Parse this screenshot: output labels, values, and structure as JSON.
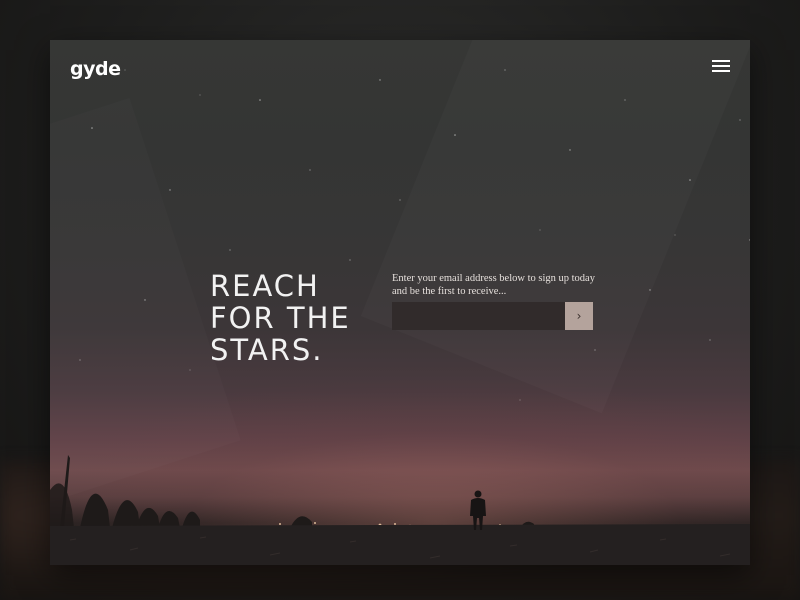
{
  "header": {
    "logo_text": "gyde",
    "menu_icon": "hamburger-menu-icon"
  },
  "hero": {
    "headline_lines": [
      "REACH",
      "FOR THE",
      "STARS."
    ],
    "signup_text": "Enter your email address below to sign up today and be the first to receive...",
    "email_value": "",
    "email_placeholder": "",
    "submit_glyph": "›",
    "submit_icon": "chevron-right-icon"
  },
  "colors": {
    "text": "#ffffff",
    "input_bg": "#312b2b",
    "button_bg": "#b4a39c",
    "sky_top": "#363735",
    "horizon_glow": "#6e4a4c"
  }
}
